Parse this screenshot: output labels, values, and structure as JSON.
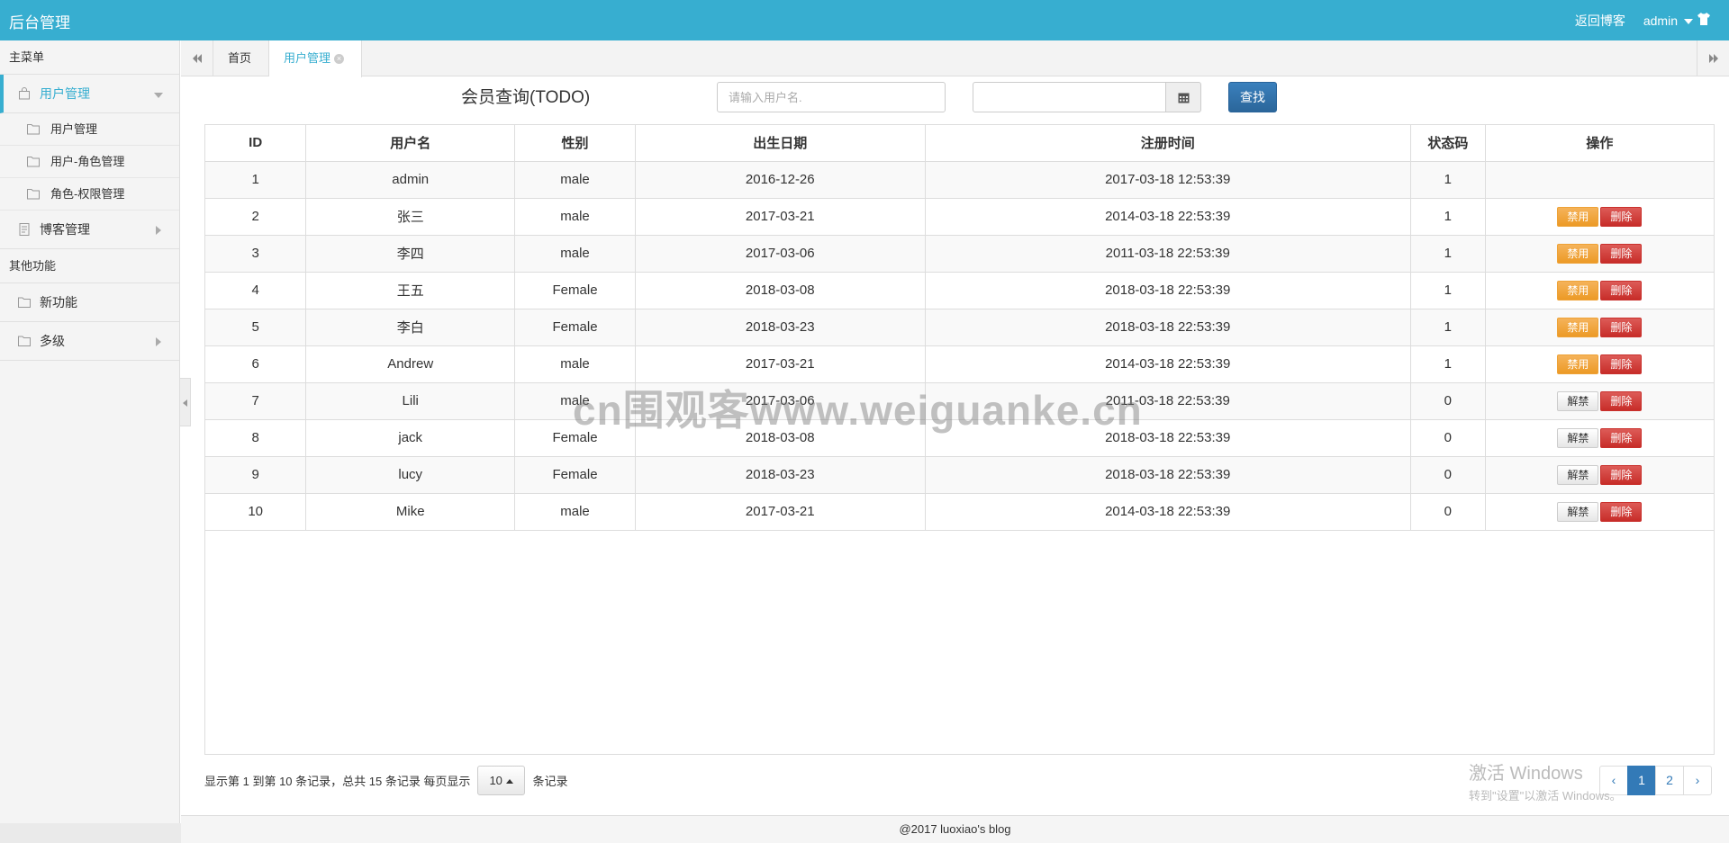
{
  "header": {
    "brand": "后台管理",
    "back_link": "返回博客",
    "user": "admin",
    "accent_color": "#37aed0"
  },
  "sidebar": {
    "main_menu_label": "主菜单",
    "user_mgmt": {
      "label": "用户管理",
      "icon": "bag-icon",
      "children": [
        {
          "label": "用户管理",
          "icon": "folder-icon"
        },
        {
          "label": "用户-角色管理",
          "icon": "folder-icon"
        },
        {
          "label": "角色-权限管理",
          "icon": "folder-icon"
        }
      ]
    },
    "blog_mgmt": {
      "label": "博客管理",
      "icon": "document-icon"
    },
    "other_label": "其他功能",
    "new_feature": {
      "label": "新功能",
      "icon": "folder-icon"
    },
    "multilevel": {
      "label": "多级",
      "icon": "folder-icon"
    }
  },
  "tabs": {
    "home": "首页",
    "active": "用户管理"
  },
  "search": {
    "title": "会员查询(TODO)",
    "username_placeholder": "请输入用户名.",
    "date_value": "",
    "find_label": "查找"
  },
  "table": {
    "headers": [
      "ID",
      "用户名",
      "性别",
      "出生日期",
      "注册时间",
      "状态码",
      "操作"
    ],
    "rows": [
      {
        "id": "1",
        "name": "admin",
        "gender": "male",
        "birth": "2016-12-26",
        "reg": "2017-03-18 12:53:39",
        "status": "1",
        "toggle": ""
      },
      {
        "id": "2",
        "name": "张三",
        "gender": "male",
        "birth": "2017-03-21",
        "reg": "2014-03-18 22:53:39",
        "status": "1",
        "toggle": "禁用"
      },
      {
        "id": "3",
        "name": "李四",
        "gender": "male",
        "birth": "2017-03-06",
        "reg": "2011-03-18 22:53:39",
        "status": "1",
        "toggle": "禁用"
      },
      {
        "id": "4",
        "name": "王五",
        "gender": "Female",
        "birth": "2018-03-08",
        "reg": "2018-03-18 22:53:39",
        "status": "1",
        "toggle": "禁用"
      },
      {
        "id": "5",
        "name": "李白",
        "gender": "Female",
        "birth": "2018-03-23",
        "reg": "2018-03-18 22:53:39",
        "status": "1",
        "toggle": "禁用"
      },
      {
        "id": "6",
        "name": "Andrew",
        "gender": "male",
        "birth": "2017-03-21",
        "reg": "2014-03-18 22:53:39",
        "status": "1",
        "toggle": "禁用"
      },
      {
        "id": "7",
        "name": "Lili",
        "gender": "male",
        "birth": "2017-03-06",
        "reg": "2011-03-18 22:53:39",
        "status": "0",
        "toggle": "解禁"
      },
      {
        "id": "8",
        "name": "jack",
        "gender": "Female",
        "birth": "2018-03-08",
        "reg": "2018-03-18 22:53:39",
        "status": "0",
        "toggle": "解禁"
      },
      {
        "id": "9",
        "name": "lucy",
        "gender": "Female",
        "birth": "2018-03-23",
        "reg": "2018-03-18 22:53:39",
        "status": "0",
        "toggle": "解禁"
      },
      {
        "id": "10",
        "name": "Mike",
        "gender": "male",
        "birth": "2017-03-21",
        "reg": "2014-03-18 22:53:39",
        "status": "0",
        "toggle": "解禁"
      }
    ],
    "delete_label": "删除"
  },
  "pager": {
    "info_prefix": "显示第 1 到第 10 条记录，总共 15 条记录 每页显示",
    "page_size": "10",
    "info_suffix": "条记录",
    "prev": "‹",
    "pages": [
      "1",
      "2"
    ],
    "next": "›",
    "current_page": "1"
  },
  "overlays": {
    "site_watermark": "cn围观客www.weiguanke.cn",
    "windows_line1": "激活 Windows",
    "windows_line2": "转到\"设置\"以激活 Windows。"
  },
  "footer": "@2017 luoxiao's blog"
}
